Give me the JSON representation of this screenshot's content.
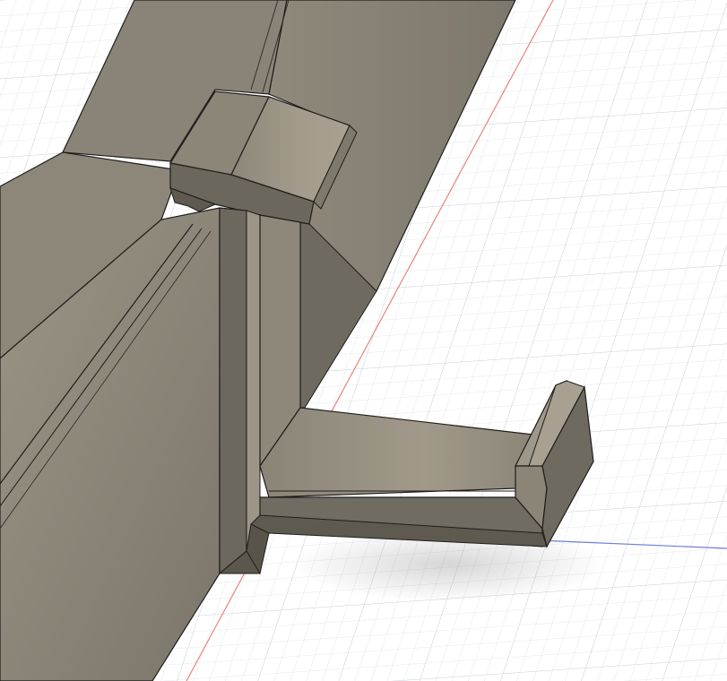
{
  "app": {
    "view": "3d-cad-viewport",
    "scene": "headphone-hanger-model"
  },
  "colors": {
    "background": "#ffffff",
    "grid_minor": "#e6e8ec",
    "grid_major": "#cdd2d9",
    "axis_red": "#e8837a",
    "axis_blue": "#6f7fd6",
    "body_light": "#a59e90",
    "body_mid": "#8f897b",
    "body_dark": "#6f6a5f",
    "body_shadow": "#5f5a50",
    "edge": "#1f1d1a"
  },
  "icons": {
    "model": "headphone-hanger-icon"
  }
}
